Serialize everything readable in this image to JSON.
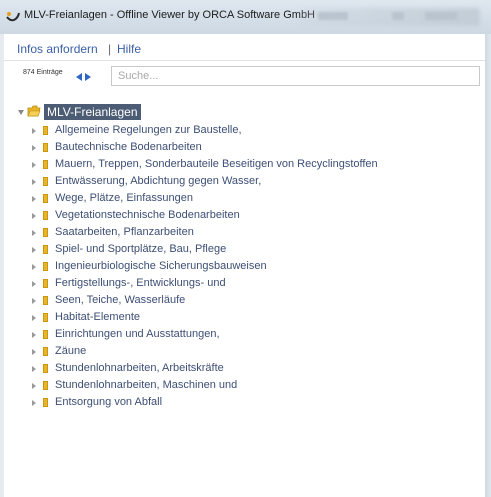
{
  "window": {
    "title": "MLV-Freianlagen - Offline Viewer by ORCA Software GmbH"
  },
  "menu": {
    "items": [
      "Infos anfordern",
      "Hilfe"
    ],
    "separator": "|"
  },
  "toolbar": {
    "count": "874 Einträge",
    "search_placeholder": "Suche..."
  },
  "tree": {
    "root": "MLV-Freianlagen",
    "children": [
      "Allgemeine Regelungen zur Baustelle,",
      "Bautechnische Bodenarbeiten",
      "Mauern, Treppen, Sonderbauteile Beseitigen von Recyclingstoffen",
      "Entwässerung, Abdichtung gegen Wasser,",
      "Wege, Plätze, Einfassungen",
      "Vegetationstechnische Bodenarbeiten",
      "Saatarbeiten, Pflanzarbeiten",
      "Spiel- und Sportplätze, Bau, Pflege",
      "Ingenieurbiologische Sicherungsbauweisen",
      "Fertigstellungs-, Entwicklungs- und",
      "Seen, Teiche, Wasserläufe",
      "Habitat-Elemente",
      "Einrichtungen und Ausstattungen,",
      "Zäune",
      "Stundenlohnarbeiten, Arbeitskräfte",
      "Stundenlohnarbeiten, Maschinen und",
      "Entsorgung von Abfall"
    ]
  },
  "colors": {
    "link": "#3a5fa4",
    "tree_text": "#3d4f74",
    "root_highlight": "#4b5c74",
    "folder": "#e8b528",
    "nav_arrow": "#2f66c4"
  }
}
